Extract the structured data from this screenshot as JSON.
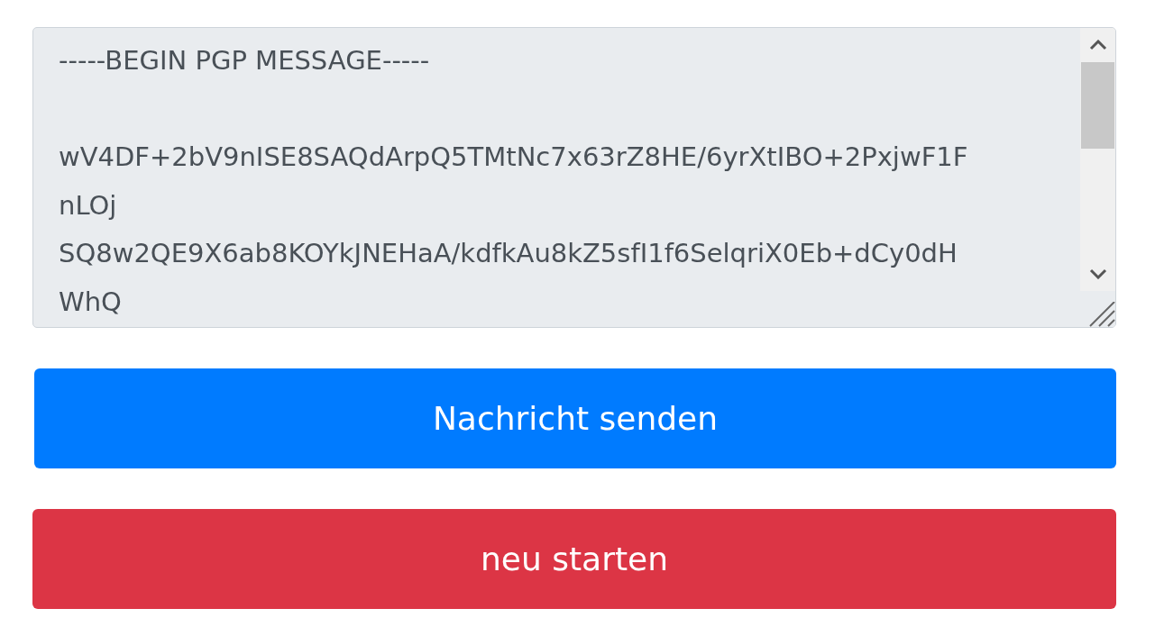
{
  "message_field": {
    "disabled": true,
    "header": "-----BEGIN PGP MESSAGE-----",
    "lines": [
      "wV4DF+2bV9nISE8SAQdArpQ5TMtNc7x63rZ8HE/6yrXtIBO+2PxjwF1F",
      "nLOj",
      "SQ8w2QE9X6ab8KOYkJNEHaA/kdfkAu8kZ5sfI1f6SelqriX0Eb+dCy0dH",
      "WhQ"
    ]
  },
  "buttons": [
    {
      "label": "Nachricht senden",
      "kind": "primary"
    },
    {
      "label": "neu starten",
      "kind": "danger"
    }
  ]
}
